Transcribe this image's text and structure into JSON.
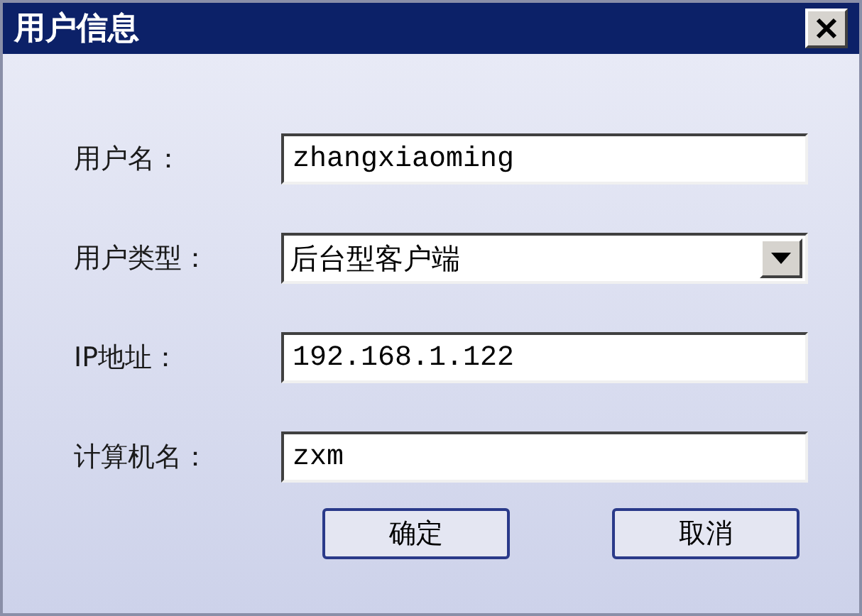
{
  "window": {
    "title": "用户信息"
  },
  "fields": [
    {
      "kind": "text",
      "label": "用户名：",
      "value": "zhangxiaoming"
    },
    {
      "kind": "select",
      "label": "用户类型：",
      "value": "后台型客户端"
    },
    {
      "kind": "text",
      "label": "IP地址：",
      "value": "192.168.1.122"
    },
    {
      "kind": "text",
      "label": "计算机名：",
      "value": "zxm"
    }
  ],
  "buttons": [
    "确定",
    "取消"
  ]
}
